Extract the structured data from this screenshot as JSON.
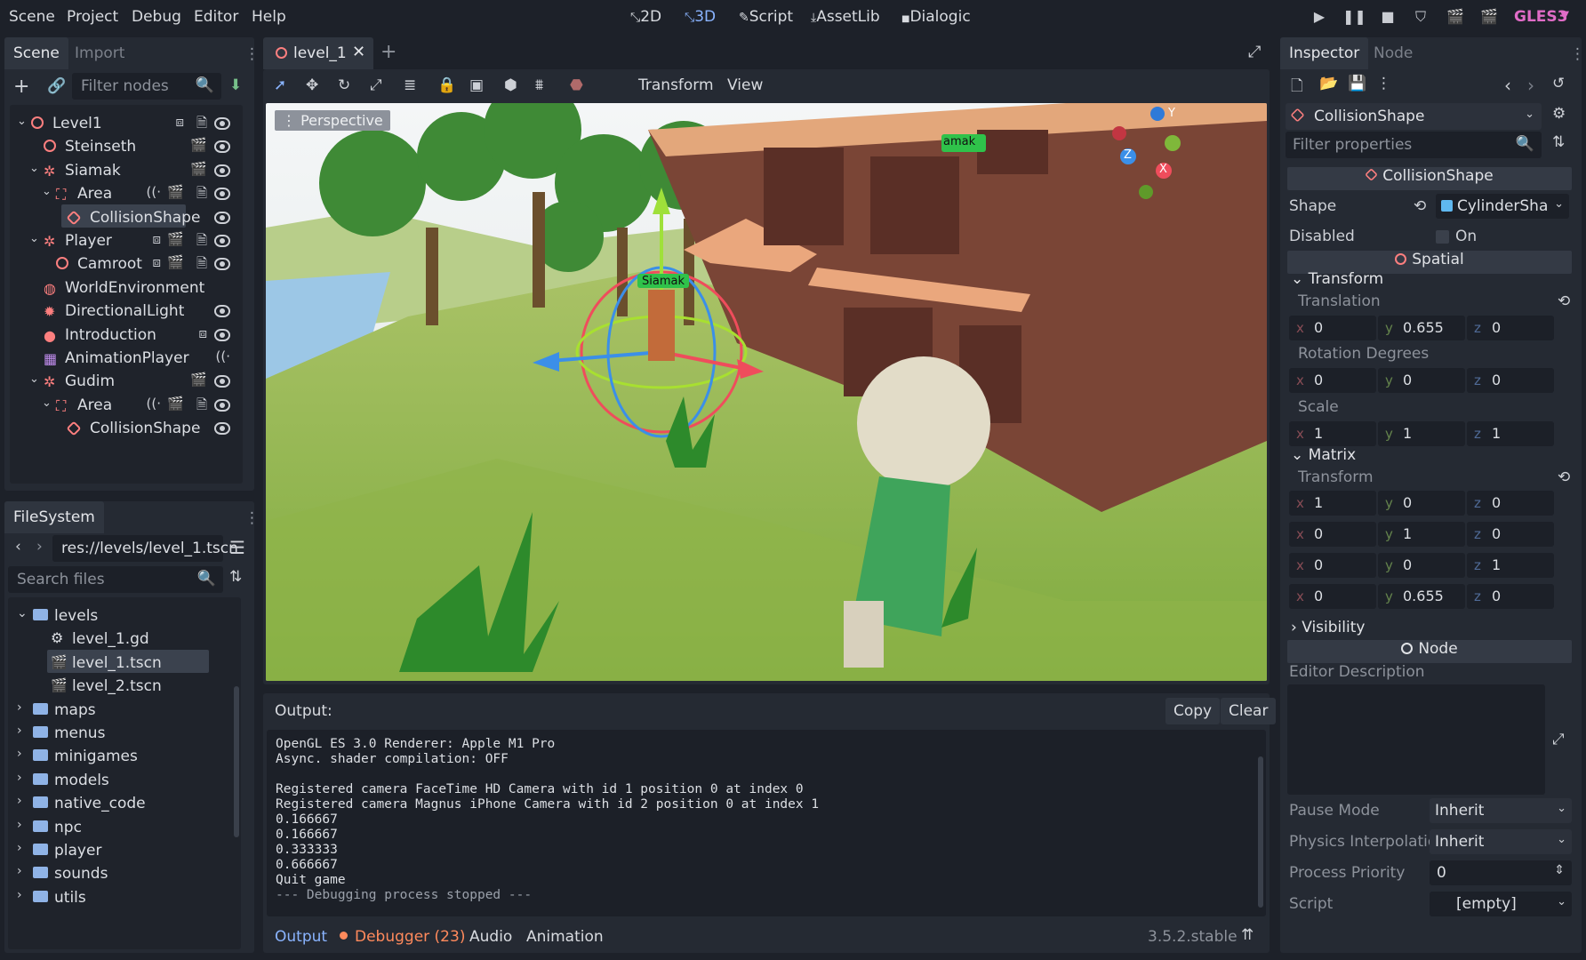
{
  "menubar": {
    "menus": [
      "Scene",
      "Project",
      "Debug",
      "Editor",
      "Help"
    ],
    "workspaces": [
      "2D",
      "3D",
      "Script",
      "AssetLib",
      "Dialogic"
    ],
    "active_workspace": "3D",
    "renderer": "GLES3"
  },
  "scene_dock": {
    "tabs": [
      "Scene",
      "Import"
    ],
    "filter_placeholder": "Filter nodes",
    "tree": [
      {
        "label": "Level1"
      },
      {
        "label": "Steinseth"
      },
      {
        "label": "Siamak"
      },
      {
        "label": "Area"
      },
      {
        "label": "CollisionShape"
      },
      {
        "label": "Player"
      },
      {
        "label": "Camroot"
      },
      {
        "label": "WorldEnvironment"
      },
      {
        "label": "DirectionalLight"
      },
      {
        "label": "Introduction"
      },
      {
        "label": "AnimationPlayer"
      },
      {
        "label": "Gudim"
      },
      {
        "label": "Area"
      },
      {
        "label": "CollisionShape"
      }
    ]
  },
  "filesystem_dock": {
    "title": "FileSystem",
    "path": "res://levels/level_1.tscn",
    "search_placeholder": "Search files",
    "items": [
      {
        "label": "levels"
      },
      {
        "label": "level_1.gd"
      },
      {
        "label": "level_1.tscn"
      },
      {
        "label": "level_2.tscn"
      },
      {
        "label": "maps"
      },
      {
        "label": "menus"
      },
      {
        "label": "minigames"
      },
      {
        "label": "models"
      },
      {
        "label": "native_code"
      },
      {
        "label": "npc"
      },
      {
        "label": "player"
      },
      {
        "label": "sounds"
      },
      {
        "label": "utils"
      }
    ]
  },
  "editor": {
    "scene_tab": "level_1",
    "toolbar_menus": [
      "Transform",
      "View"
    ],
    "viewport_label": "Perspective",
    "labels_in_viewport": [
      "Siamak",
      "amak"
    ],
    "gizmo_axes": [
      "Y",
      "Z",
      "X"
    ]
  },
  "output": {
    "title": "Output:",
    "copy_label": "Copy",
    "clear_label": "Clear",
    "lines": [
      "OpenGL ES 3.0 Renderer: Apple M1 Pro",
      "Async. shader compilation: OFF",
      "",
      "Registered camera FaceTime HD Camera with id 1 position 0 at index 0",
      "Registered camera Magnus iPhone Camera with id 2 position 0 at index 1",
      "0.166667",
      "0.166667",
      "0.333333",
      "0.666667",
      "Quit game",
      "--- Debugging process stopped ---"
    ],
    "bottom_tabs": [
      "Output",
      "Debugger (23)",
      "Audio",
      "Animation"
    ],
    "version": "3.5.2.stable"
  },
  "inspector": {
    "tabs": [
      "Inspector",
      "Node"
    ],
    "object_name": "CollisionShape",
    "filter_placeholder": "Filter properties",
    "class_header": "CollisionShape",
    "shape_label": "Shape",
    "shape_value": "CylinderSha",
    "disabled_label": "Disabled",
    "disabled_value": "On",
    "spatial_header": "Spatial",
    "transform_section": "Transform",
    "translation_label": "Translation",
    "translation": {
      "x": "0",
      "y": "0.655",
      "z": "0"
    },
    "rotation_label": "Rotation Degrees",
    "rotation": {
      "x": "0",
      "y": "0",
      "z": "0"
    },
    "scale_label": "Scale",
    "scale": {
      "x": "1",
      "y": "1",
      "z": "1"
    },
    "matrix_section": "Matrix",
    "matrix_label": "Transform",
    "matrix": [
      {
        "x": "1",
        "y": "0",
        "z": "0"
      },
      {
        "x": "0",
        "y": "1",
        "z": "0"
      },
      {
        "x": "0",
        "y": "0",
        "z": "1"
      },
      {
        "x": "0",
        "y": "0.655",
        "z": "0"
      }
    ],
    "visibility_section": "Visibility",
    "node_header": "Node",
    "editor_description_label": "Editor Description",
    "pause_mode_label": "Pause Mode",
    "pause_mode_value": "Inherit",
    "physics_interp_label": "Physics Interpolatio",
    "physics_interp_value": "Inherit",
    "process_priority_label": "Process Priority",
    "process_priority_value": "0",
    "script_label": "Script",
    "script_value": "[empty]"
  },
  "colors": {
    "accent": "#8ab4ff",
    "node_red": "#fc7f7f",
    "debugger_orange": "#ff8a5c",
    "renderer": "#e06cc7"
  }
}
